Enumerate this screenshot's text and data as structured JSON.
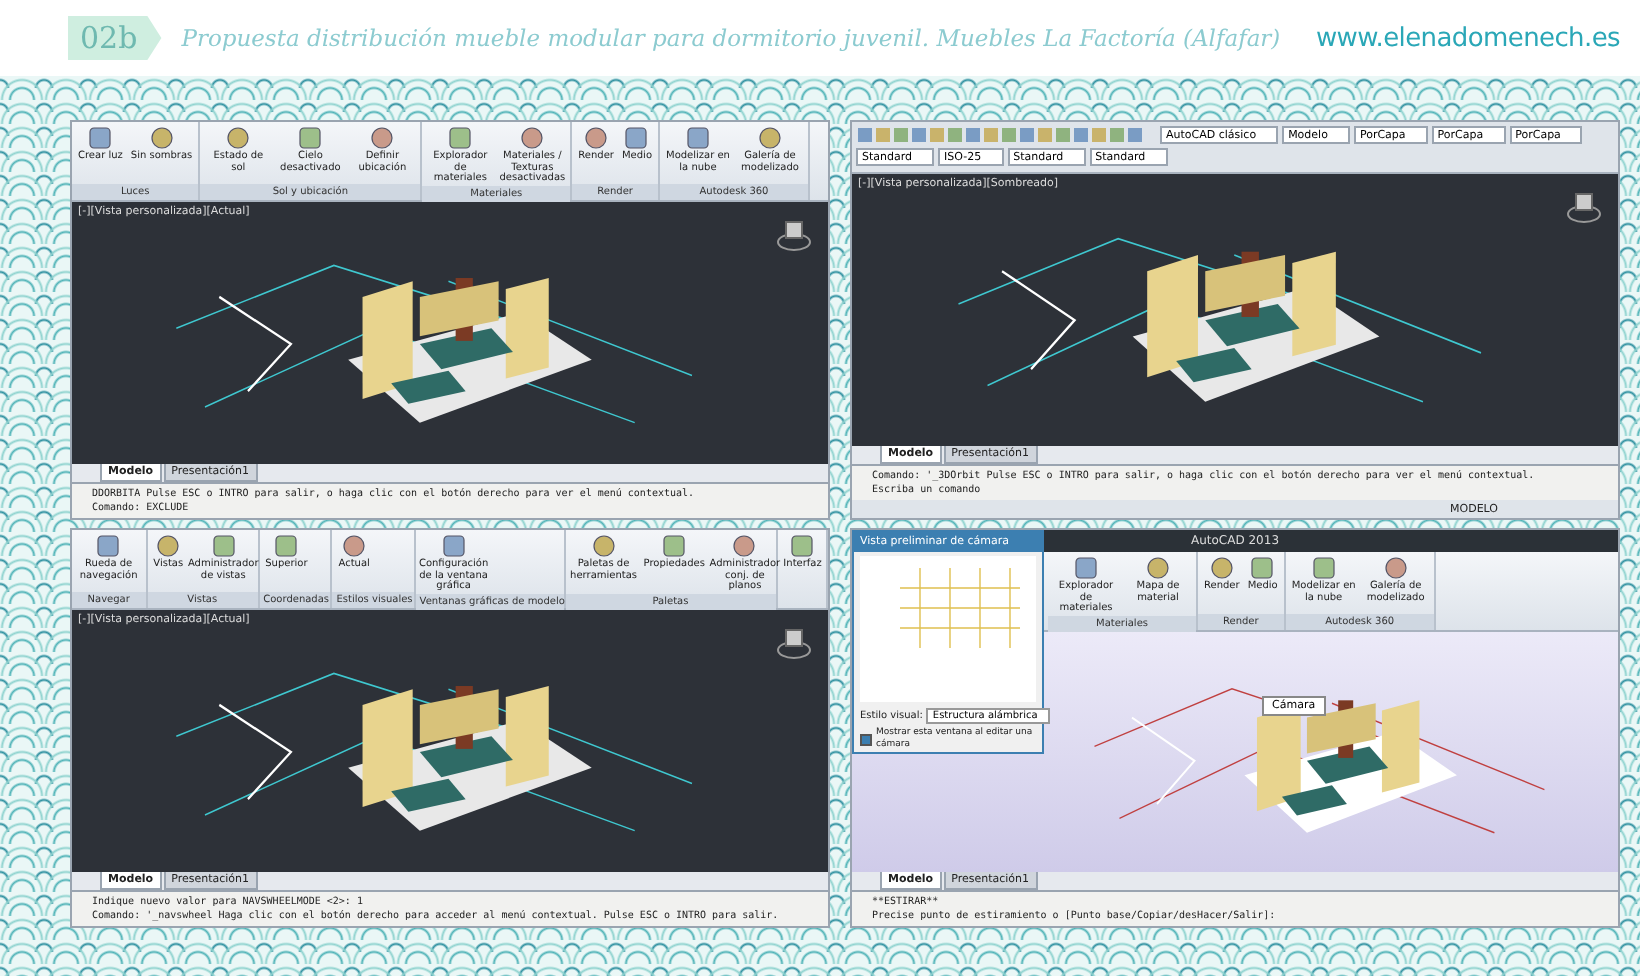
{
  "header": {
    "badge": "02b",
    "title": "Propuesta distribución mueble modular para dormitorio juvenil. Muebles La Factoría (Alfafar)",
    "website": "www.elenadomenech.es"
  },
  "panels": [
    {
      "kind": "ribbon",
      "groups": [
        {
          "label": "Luces",
          "tools": [
            "Crear luz",
            "Sin sombras"
          ]
        },
        {
          "label": "Sol y ubicación",
          "tools": [
            "Estado de sol",
            "Cielo desactivado",
            "Definir ubicación"
          ]
        },
        {
          "label": "Materiales",
          "tools": [
            "Explorador de materiales",
            "Materiales / Texturas desactivadas"
          ]
        },
        {
          "label": "Render",
          "tools": [
            "Render",
            "Medio"
          ]
        },
        {
          "label": "Autodesk 360",
          "tools": [
            "Modelizar en la nube",
            "Galería de modelizado"
          ]
        }
      ],
      "viewport_label": "[-][Vista personalizada][Actual]",
      "layout_tabs": [
        {
          "label": "Modelo",
          "selected": true
        },
        {
          "label": "Presentación1",
          "selected": false
        }
      ],
      "command_lines": [
        "DDORBITA Pulse ESC o INTRO para salir, o haga clic con el botón derecho para ver el menú contextual.",
        "Comando: EXCLUDE"
      ]
    },
    {
      "kind": "classic",
      "dropdowns": [
        "AutoCAD clásico",
        "Modelo",
        "PorCapa",
        "PorCapa",
        "PorCapa",
        "Standard",
        "ISO-25",
        "Standard",
        "Standard"
      ],
      "viewport_label": "[-][Vista personalizada][Sombreado]",
      "layout_tabs": [
        {
          "label": "Modelo",
          "selected": true
        },
        {
          "label": "Presentación1",
          "selected": false
        }
      ],
      "command_lines": [
        "Comando: '_3DOrbit Pulse ESC o INTRO para salir, o haga clic con el botón derecho para ver el menú contextual.",
        "Escriba un comando"
      ],
      "status": "MODELO"
    },
    {
      "kind": "ribbon",
      "groups": [
        {
          "label": "Navegar",
          "tools": [
            "Rueda de navegación"
          ]
        },
        {
          "label": "Vistas",
          "tools": [
            "Vistas",
            "Administrador de vistas"
          ]
        },
        {
          "label": "Coordenadas",
          "tools": [
            "Superior"
          ]
        },
        {
          "label": "Estilos visuales",
          "tools": [
            "Actual"
          ]
        },
        {
          "label": "Ventanas gráficas de modelo",
          "tools": [
            "Configuración de la ventana gráfica"
          ]
        },
        {
          "label": "Paletas",
          "tools": [
            "Paletas de herramientas",
            "Propiedades",
            "Administrador conj. de planos"
          ]
        },
        {
          "tools": [
            "Interfaz"
          ]
        }
      ],
      "viewport_label": "[-][Vista personalizada][Actual]",
      "layout_tabs": [
        {
          "label": "Modelo",
          "selected": true
        },
        {
          "label": "Presentación1",
          "selected": false
        }
      ],
      "command_lines": [
        "Indique nuevo valor para NAVSWHEELMODE <2>: 1",
        "Comando: '_navswheel Haga clic con el botón derecho para acceder al menú contextual. Pulse ESC o INTRO para salir."
      ]
    },
    {
      "kind": "camera",
      "app_title": "AutoCAD 2013",
      "groups": [
        {
          "label": "Materiales",
          "tools": [
            "Explorador de materiales",
            "Mapa de material"
          ]
        },
        {
          "label": "Render",
          "tools": [
            "Render",
            "Medio"
          ]
        },
        {
          "label": "Autodesk 360",
          "tools": [
            "Modelizar en la nube",
            "Galería de modelizado"
          ]
        }
      ],
      "dialog": {
        "title": "Vista preliminar de cámara",
        "style_label": "Estilo visual:",
        "style_value": "Estructura alámbrica",
        "checkbox_label": "Mostrar esta ventana al editar una cámara",
        "checked": true
      },
      "camera_tag": "Cámara",
      "layout_tabs": [
        {
          "label": "Modelo",
          "selected": true
        },
        {
          "label": "Presentación1",
          "selected": false
        }
      ],
      "command_lines": [
        "**ESTIRAR**",
        "Precise punto de estiramiento o [Punto base/Copiar/desHacer/Salir]:"
      ]
    }
  ]
}
